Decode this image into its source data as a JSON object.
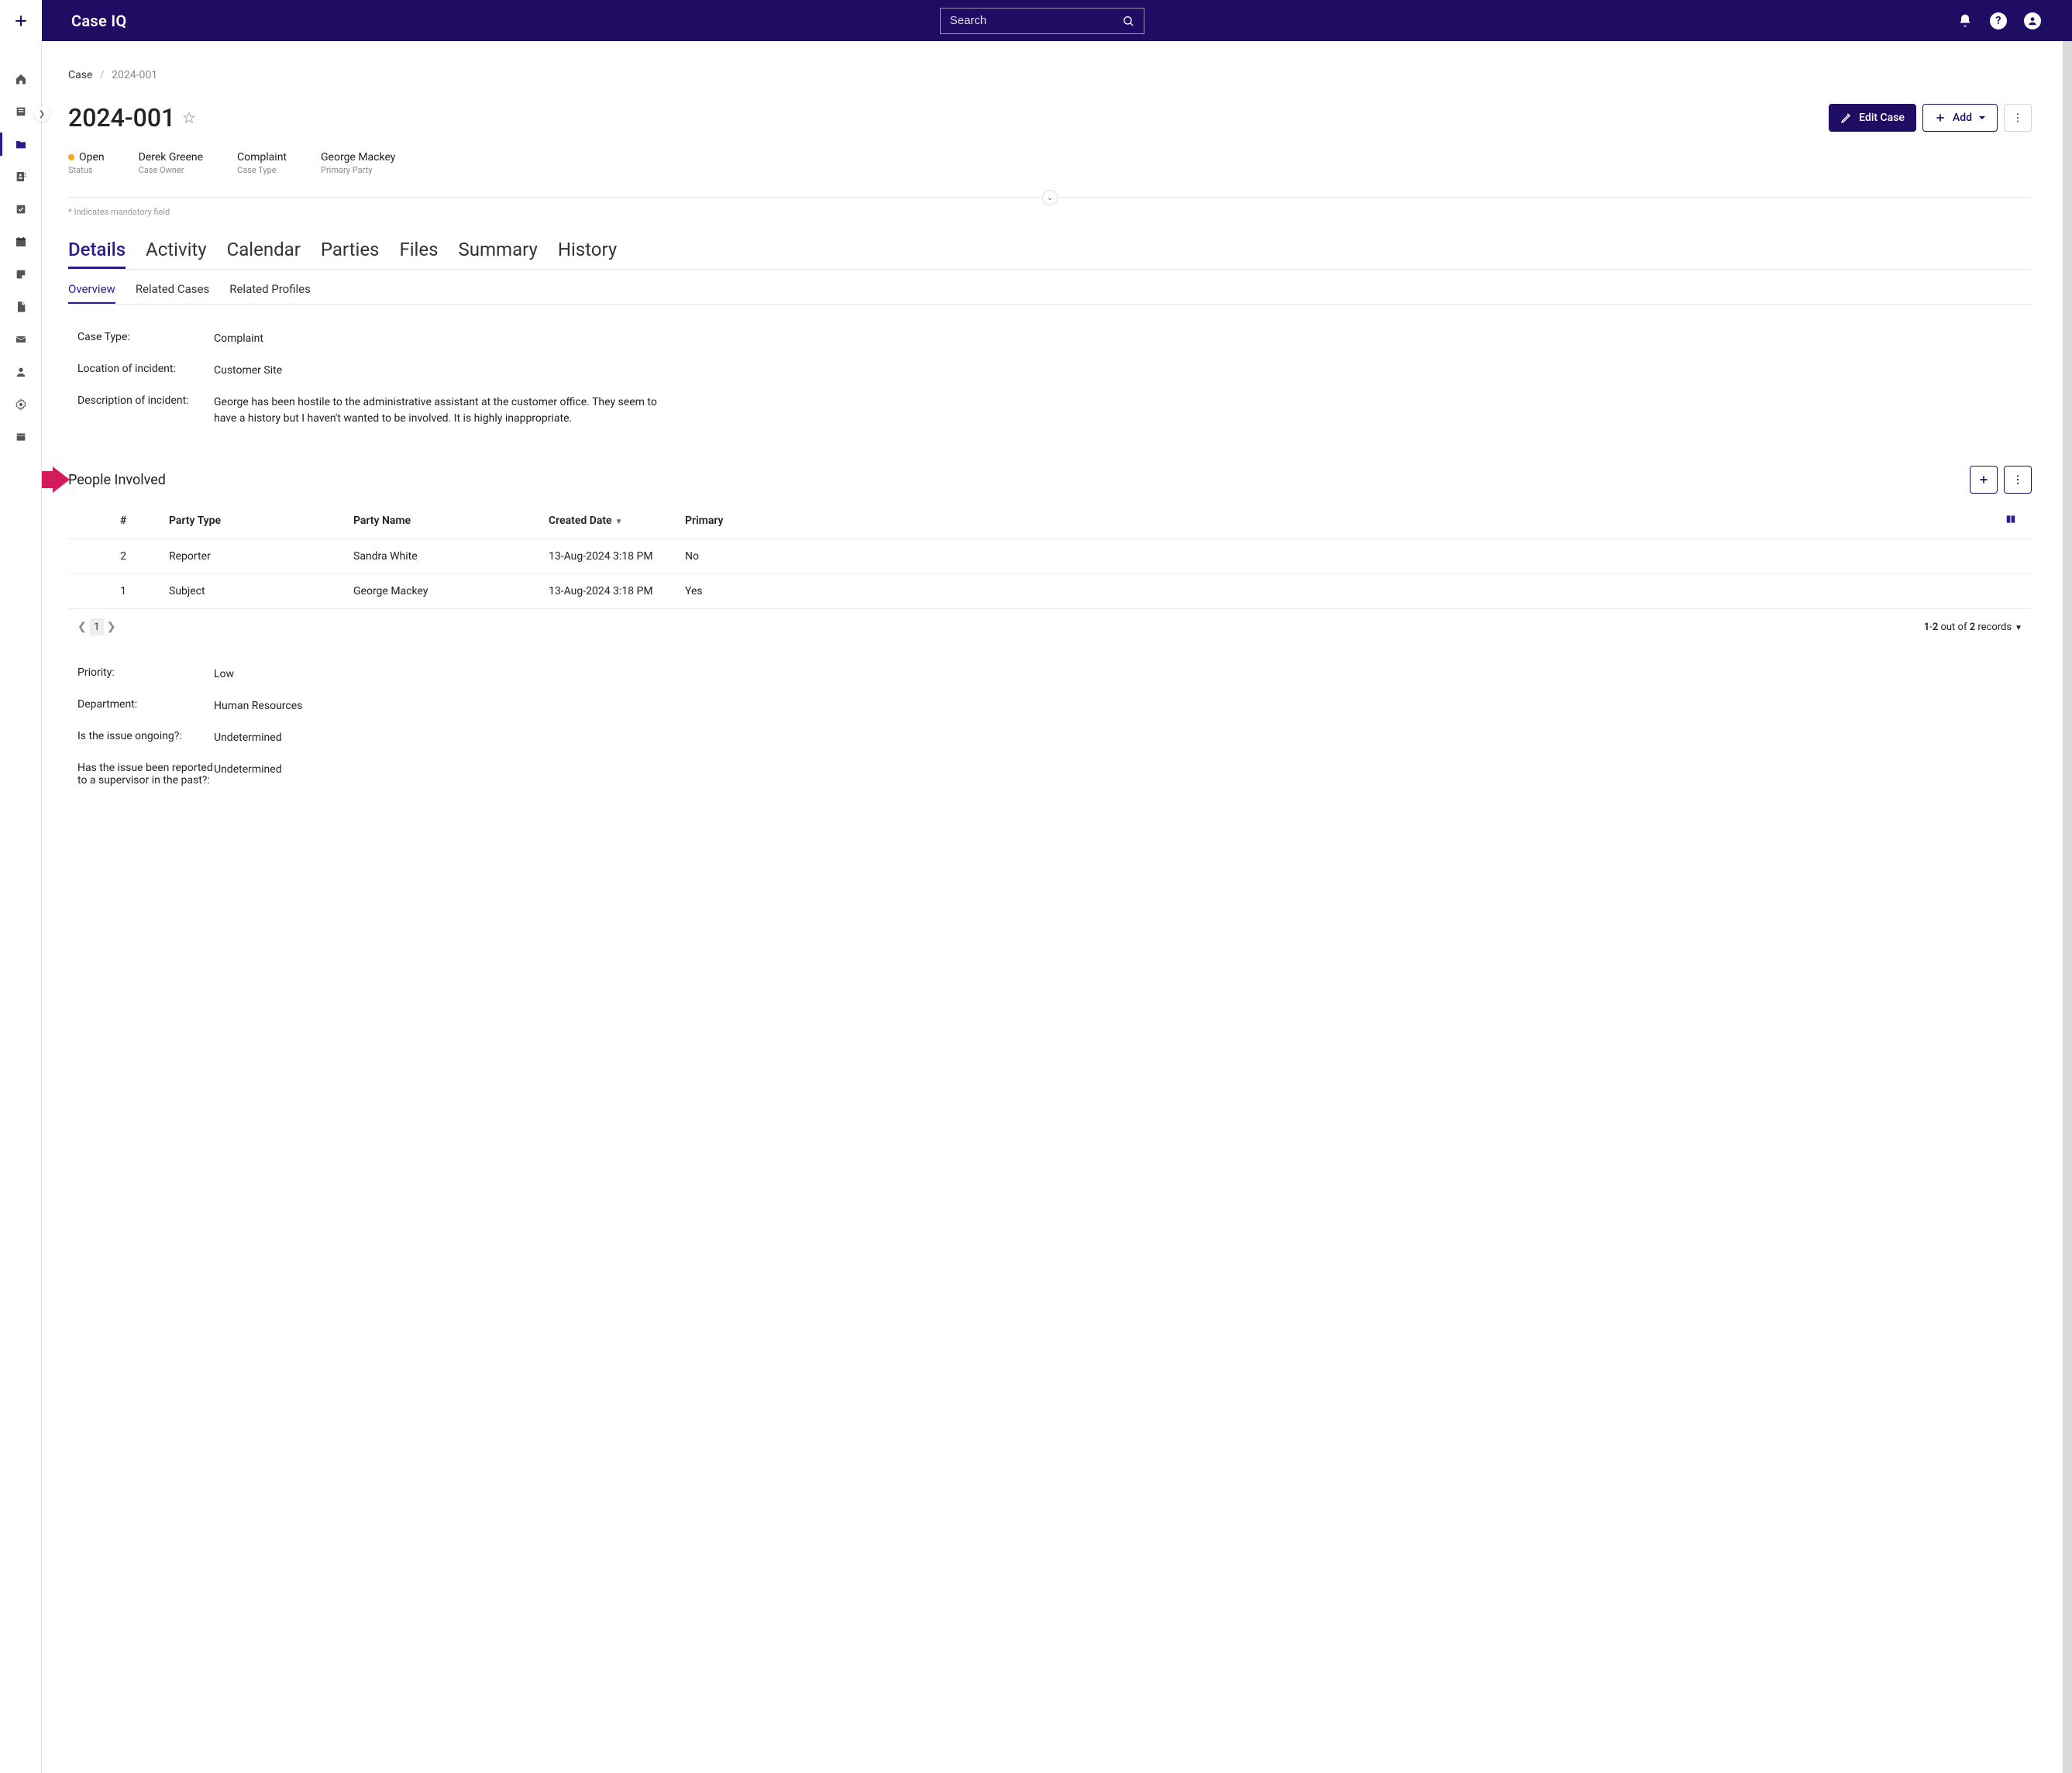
{
  "logo": "Case IQ",
  "search": {
    "placeholder": "Search"
  },
  "breadcrumb": {
    "parent": "Case",
    "current": "2024-001"
  },
  "case": {
    "title": "2024-001",
    "editLabel": "Edit Case",
    "addLabel": "Add",
    "meta": {
      "status": {
        "value": "Open",
        "label": "Status"
      },
      "owner": {
        "value": "Derek Greene",
        "label": "Case Owner"
      },
      "type": {
        "value": "Complaint",
        "label": "Case Type"
      },
      "primary": {
        "value": "George Mackey",
        "label": "Primary Party"
      }
    }
  },
  "mandatoryNote": "* Indicates mandatory field",
  "tabs": {
    "primary": [
      "Details",
      "Activity",
      "Calendar",
      "Parties",
      "Files",
      "Summary",
      "History"
    ],
    "secondary": [
      "Overview",
      "Related Cases",
      "Related Profiles"
    ]
  },
  "fieldsTop": {
    "caseTypeLabel": "Case Type:",
    "caseTypeValue": "Complaint",
    "locationLabel": "Location of incident:",
    "locationValue": "Customer Site",
    "descLabel": "Description of incident:",
    "descValue": "George has been hostile to the administrative assistant at the customer office. They seem to have a history but I haven't wanted to be involved. It is highly inappropriate."
  },
  "peopleSection": {
    "title": "People Involved",
    "columns": {
      "num": "#",
      "type": "Party Type",
      "name": "Party Name",
      "date": "Created Date",
      "primary": "Primary"
    },
    "rows": [
      {
        "num": "2",
        "type": "Reporter",
        "name": "Sandra White",
        "date": "13-Aug-2024 3:18 PM",
        "primary": "No"
      },
      {
        "num": "1",
        "type": "Subject",
        "name": "George Mackey",
        "date": "13-Aug-2024 3:18 PM",
        "primary": "Yes"
      }
    ],
    "pager": {
      "page": "1",
      "summaryPrefix": "1",
      "summarySep": "-",
      "summaryEnd": "2",
      "outof": " out of ",
      "total": "2",
      "records": " records"
    }
  },
  "fieldsBottom": {
    "priorityLabel": "Priority:",
    "priorityValue": "Low",
    "deptLabel": "Department:",
    "deptValue": "Human Resources",
    "ongoingLabel": "Is the issue ongoing?:",
    "ongoingValue": "Undetermined",
    "reportedLabel": "Has the issue been reported to a supervisor in the past?:",
    "reportedValue": "Undetermined"
  }
}
